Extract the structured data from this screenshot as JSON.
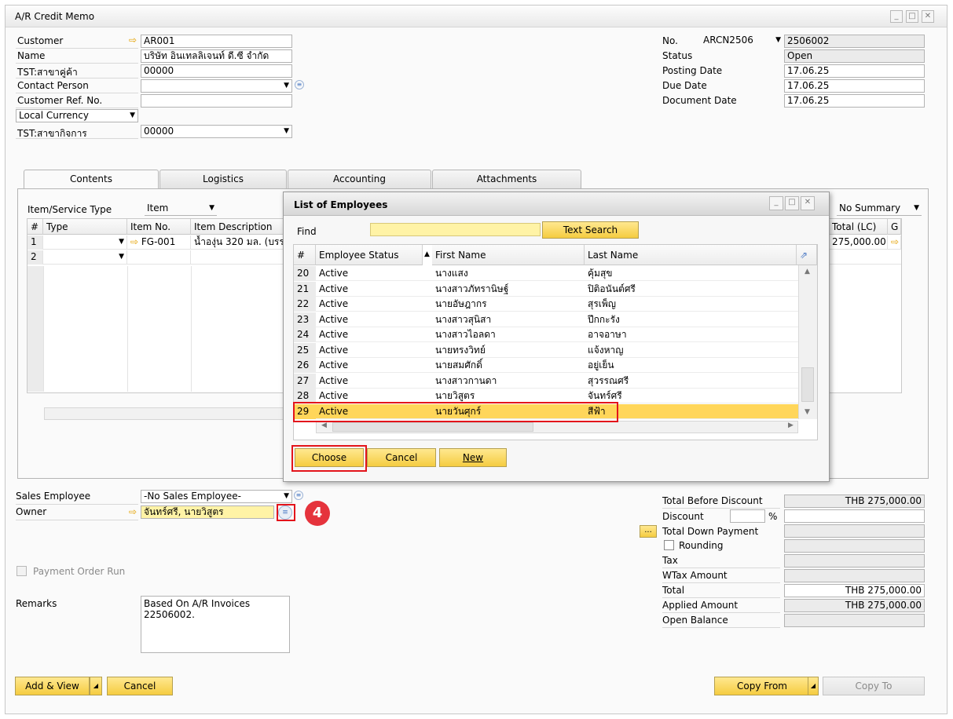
{
  "window": {
    "title": "A/R Credit Memo"
  },
  "header_left": {
    "customer_label": "Customer",
    "customer_value": "AR001",
    "name_label": "Name",
    "name_value": "บริษัท อินเทลลิเจนท์ ดี.ซี จำกัด",
    "branch_label": "TST:สาขาคู่ค้า",
    "branch_value": "00000",
    "contact_label": "Contact Person",
    "contact_value": "",
    "custref_label": "Customer Ref. No.",
    "custref_value": "",
    "currency_value": "Local Currency",
    "bizbranch_label": "TST:สาขากิจการ",
    "bizbranch_value": "00000"
  },
  "header_right": {
    "no_label": "No.",
    "series_value": "ARCN2506",
    "no_value": "2506002",
    "status_label": "Status",
    "status_value": "Open",
    "posting_label": "Posting Date",
    "posting_value": "17.06.25",
    "due_label": "Due Date",
    "due_value": "17.06.25",
    "docdate_label": "Document Date",
    "docdate_value": "17.06.25"
  },
  "tabs": [
    "Contents",
    "Logistics",
    "Accounting",
    "Attachments"
  ],
  "contents": {
    "type_label": "Item/Service Type",
    "type_value": "Item",
    "summary_value": "No Summary",
    "columns": [
      "#",
      "Type",
      "Item No.",
      "Item Description"
    ],
    "right_columns": [
      "Total (LC)",
      "G"
    ],
    "rows": [
      {
        "num": "1",
        "type": "",
        "item_no": "FG-001",
        "desc": "น้ำองุ่น 320 มล. (บรร",
        "total": "275,000.00"
      },
      {
        "num": "2",
        "type": "",
        "item_no": "",
        "desc": "",
        "total": ""
      }
    ]
  },
  "popup": {
    "title": "List of Employees",
    "find_label": "Find",
    "find_value": "",
    "search_button": "Text Search",
    "columns": [
      "#",
      "Employee Status",
      "First Name",
      "Last Name"
    ],
    "rows": [
      {
        "num": "20",
        "status": "Active",
        "first": "นางแสง",
        "last": "คุ้มสุข"
      },
      {
        "num": "21",
        "status": "Active",
        "first": "นางสาวภัทรานิษฐ์",
        "last": "ปิติอนันต์ศรี"
      },
      {
        "num": "22",
        "status": "Active",
        "first": "นายอัษฎากร",
        "last": "สุรเพ็ญ"
      },
      {
        "num": "23",
        "status": "Active",
        "first": "นางสาวสุนิสา",
        "last": "ปึกกะรัง"
      },
      {
        "num": "24",
        "status": "Active",
        "first": "นางสาวไอลดา",
        "last": "อาจอาษา"
      },
      {
        "num": "25",
        "status": "Active",
        "first": "นายทรงวิทย์",
        "last": "แจ้งหาญ"
      },
      {
        "num": "26",
        "status": "Active",
        "first": "นายสมศักดิ์",
        "last": "อยู่เย็น"
      },
      {
        "num": "27",
        "status": "Active",
        "first": "นางสาวกานดา",
        "last": "สุวรรณศรี"
      },
      {
        "num": "28",
        "status": "Active",
        "first": "นายวิสูตร",
        "last": "จันทร์ศรี"
      },
      {
        "num": "29",
        "status": "Active",
        "first": "นายวันศุกร์",
        "last": "สีฟ้า"
      }
    ],
    "choose_button": "Choose",
    "cancel_button": "Cancel",
    "new_button": "New"
  },
  "footer_left": {
    "sales_emp_label": "Sales Employee",
    "sales_emp_value": "-No Sales Employee-",
    "owner_label": "Owner",
    "owner_value": "จันทร์ศรี, นายวิสูตร",
    "step_badge": "4",
    "payment_run_label": "Payment Order Run",
    "remarks_label": "Remarks",
    "remarks_value": "Based On A/R Invoices\n22506002."
  },
  "totals": {
    "before_discount_label": "Total Before Discount",
    "before_discount_value": "THB 275,000.00",
    "discount_label": "Discount",
    "discount_pct_value": "",
    "pct_symbol": "%",
    "discount_value": "",
    "down_payment_label": "Total Down Payment",
    "down_payment_value": "",
    "rounding_label": "Rounding",
    "tax_label": "Tax",
    "tax_value": "",
    "wtax_label": "WTax Amount",
    "wtax_value": "",
    "total_label": "Total",
    "total_value": "THB 275,000.00",
    "applied_label": "Applied Amount",
    "applied_value": "THB 275,000.00",
    "open_balance_label": "Open Balance",
    "open_balance_value": ""
  },
  "buttons": {
    "add_view": "Add & View",
    "cancel": "Cancel",
    "copy_from": "Copy From",
    "copy_to": "Copy To",
    "dots": "..."
  }
}
